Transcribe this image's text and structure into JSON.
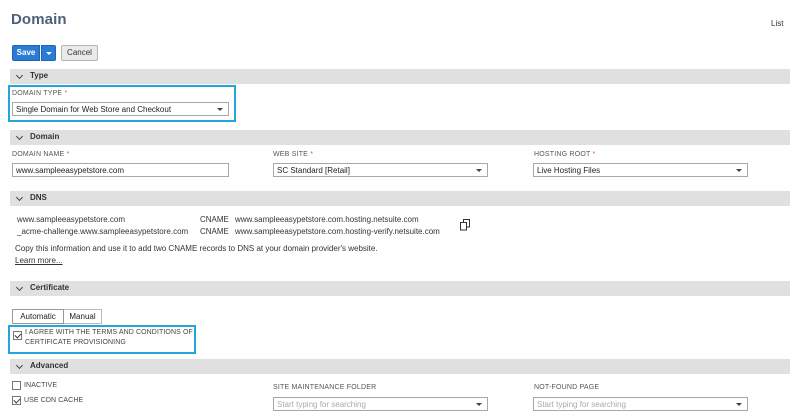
{
  "header": {
    "title": "Domain",
    "list_link": "List"
  },
  "toolbar": {
    "save_label": "Save",
    "cancel_label": "Cancel"
  },
  "sections": {
    "type": "Type",
    "domain": "Domain",
    "dns": "DNS",
    "certificate": "Certificate",
    "advanced": "Advanced"
  },
  "type_section": {
    "domain_type_label": "DOMAIN TYPE",
    "domain_type_value": "Single Domain for Web Store and Checkout"
  },
  "domain_section": {
    "domain_name_label": "DOMAIN NAME",
    "domain_name_value": "www.sampleeasypetstore.com",
    "web_site_label": "WEB SITE",
    "web_site_value": "SC Standard [Retail]",
    "hosting_root_label": "HOSTING ROOT",
    "hosting_root_value": "Live Hosting Files"
  },
  "dns_section": {
    "records": [
      {
        "host": "www.sampleeasypetstore.com",
        "type": "CNAME",
        "target": "www.sampleeasypetstore.com.hosting.netsuite.com"
      },
      {
        "host": "_acme-challenge.www.sampleeasypetstore.com",
        "type": "CNAME",
        "target": "www.sampleeasypetstore.com.hosting-verify.netsuite.com"
      }
    ],
    "info_text": "Copy this information and use it to add two CNAME records to DNS at your domain provider's website.",
    "learn_more": "Learn more..."
  },
  "certificate_section": {
    "tab_automatic": "Automatic",
    "tab_manual": "Manual",
    "agree_line1": "I AGREE WITH THE TERMS AND CONDITIONS OF",
    "agree_line2": "CERTIFICATE PROVISIONING",
    "agree_checked": true
  },
  "advanced_section": {
    "inactive_label": "INACTIVE",
    "inactive_checked": false,
    "cdn_label": "USE CDN CACHE",
    "cdn_checked": true,
    "maintenance_label": "SITE MAINTENANCE FOLDER",
    "maintenance_placeholder": "Start typing for searching",
    "notfound_label": "NOT-FOUND PAGE",
    "notfound_placeholder": "Start typing for searching"
  },
  "required_marker": "*",
  "colors": {
    "primary_button": "#2a7bd4",
    "section_bar": "#e0e0e0",
    "highlight_border": "#23a6d8",
    "title": "#4d5f79"
  }
}
